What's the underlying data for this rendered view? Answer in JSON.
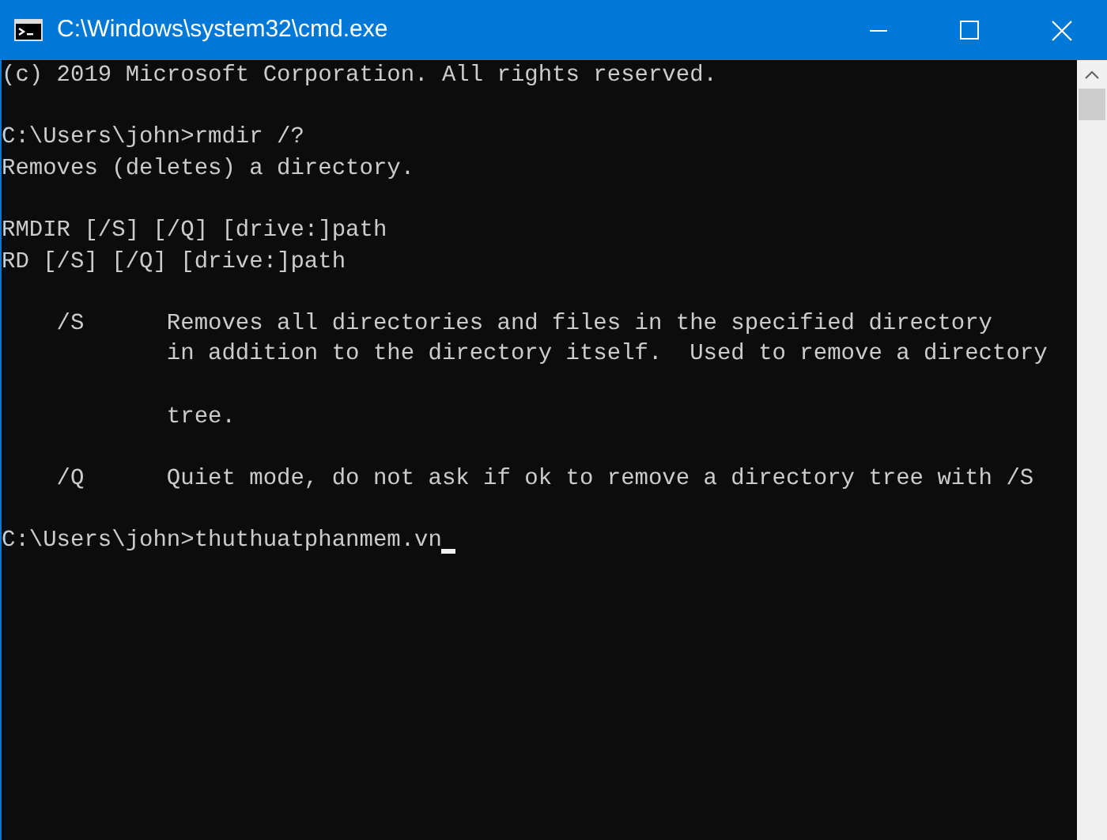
{
  "window": {
    "title": "C:\\Windows\\system32\\cmd.exe"
  },
  "console": {
    "lines": [
      {
        "kind": "text",
        "text": "(c) 2019 Microsoft Corporation. All rights reserved."
      },
      {
        "kind": "blank"
      },
      {
        "kind": "text",
        "text": "C:\\Users\\john>rmdir /?"
      },
      {
        "kind": "text",
        "text": "Removes (deletes) a directory."
      },
      {
        "kind": "blank"
      },
      {
        "kind": "text",
        "text": "RMDIR [/S] [/Q] [drive:]path"
      },
      {
        "kind": "text",
        "text": "RD [/S] [/Q] [drive:]path"
      },
      {
        "kind": "blank"
      },
      {
        "kind": "text",
        "text": "    /S      Removes all directories and files in the specified directory"
      },
      {
        "kind": "text",
        "text": "            in addition to the directory itself.  Used to remove a directory"
      },
      {
        "kind": "blank"
      },
      {
        "kind": "text",
        "text": "            tree."
      },
      {
        "kind": "blank"
      },
      {
        "kind": "text",
        "text": "    /Q      Quiet mode, do not ask if ok to remove a directory tree with /S"
      },
      {
        "kind": "blank"
      },
      {
        "kind": "prompt",
        "text": "C:\\Users\\john>thuthuatphanmem.vn",
        "cursor": true
      }
    ]
  }
}
